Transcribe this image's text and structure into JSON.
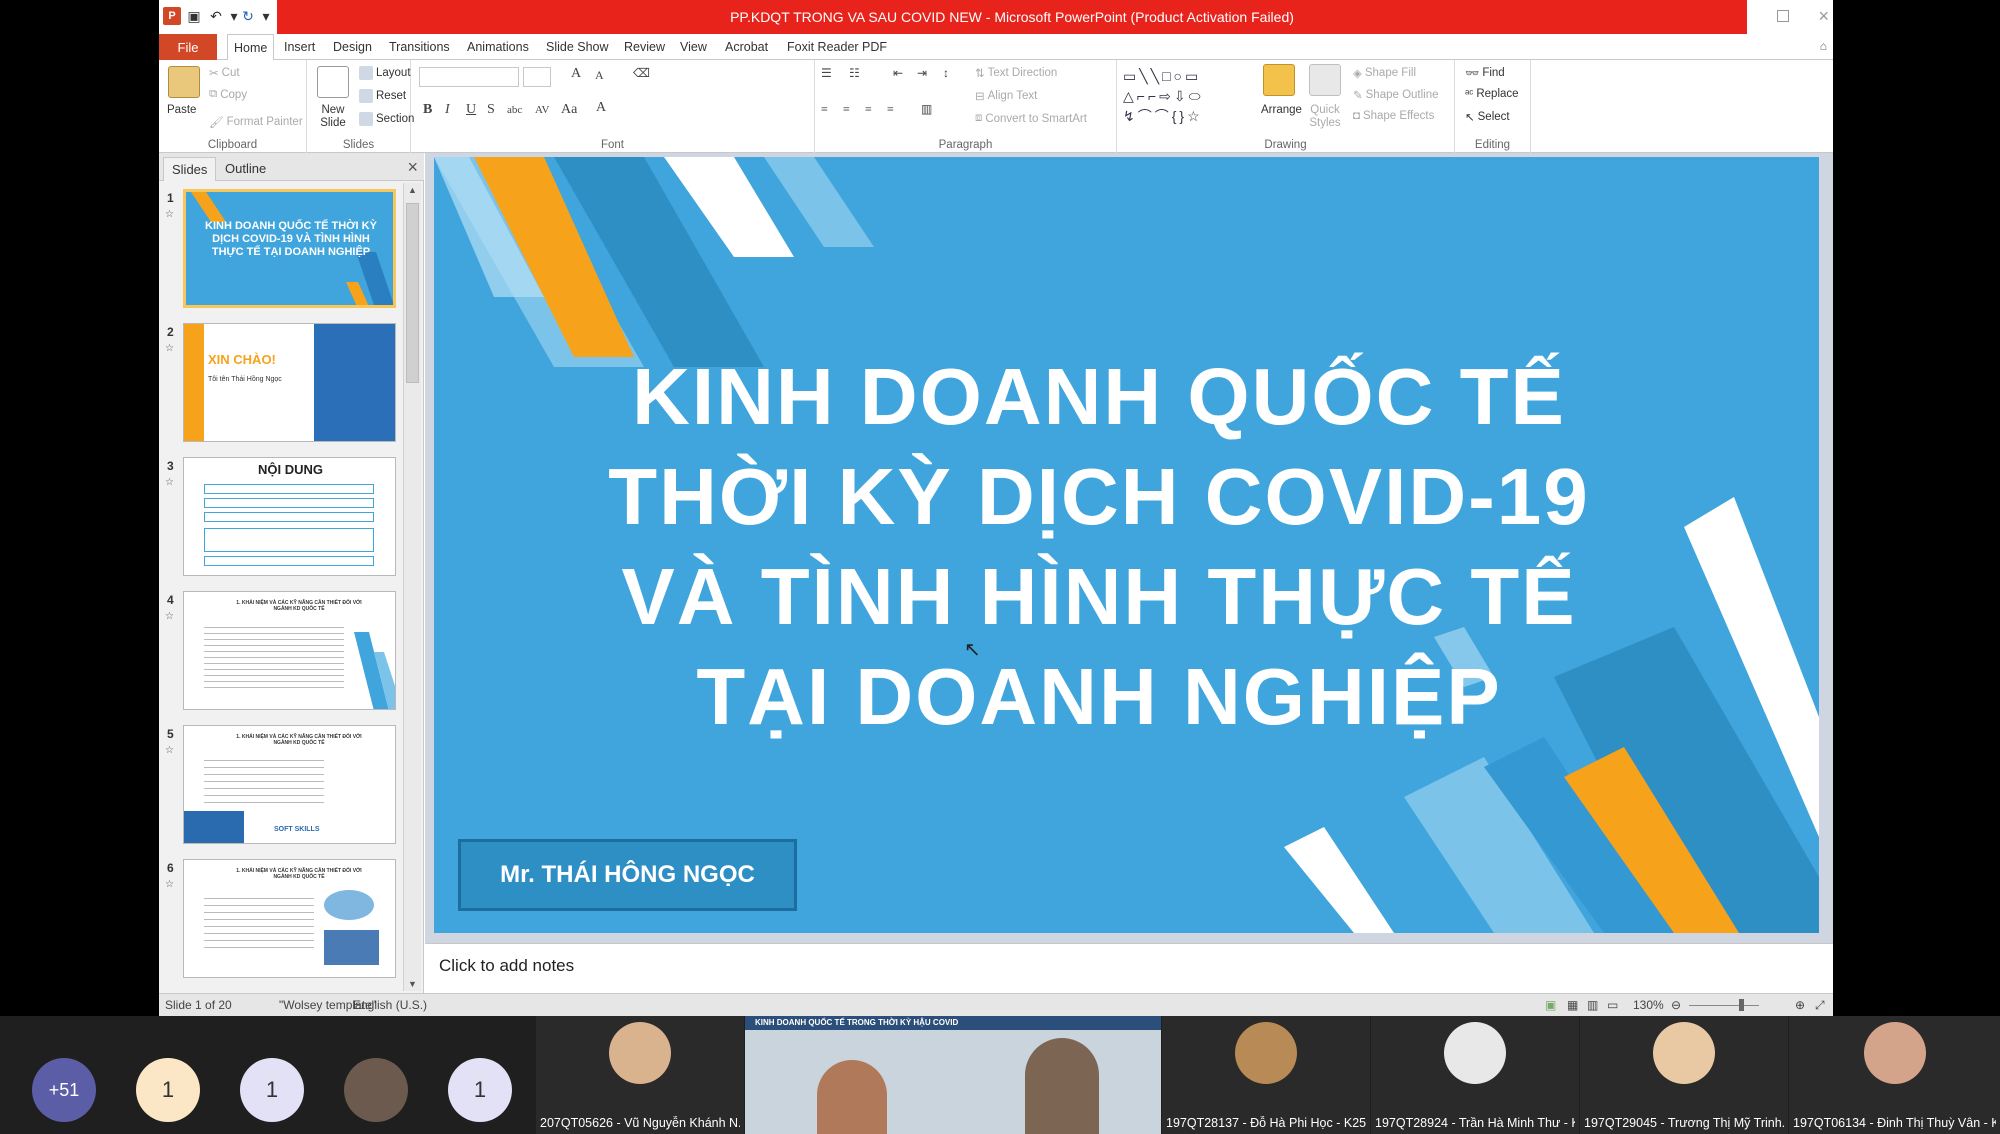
{
  "app": {
    "window_title": "PP.KDQT TRONG VA SAU COVID NEW - Microsoft PowerPoint (Product Activation Failed)"
  },
  "menu": {
    "file": "File",
    "tabs": [
      "Home",
      "Insert",
      "Design",
      "Transitions",
      "Animations",
      "Slide Show",
      "Review",
      "View",
      "Acrobat",
      "Foxit Reader PDF"
    ]
  },
  "ribbon": {
    "clipboard": {
      "label": "Clipboard",
      "paste": "Paste",
      "cut": "Cut",
      "copy": "Copy",
      "format_painter": "Format Painter"
    },
    "slides": {
      "label": "Slides",
      "new_slide": "New Slide",
      "layout": "Layout",
      "reset": "Reset",
      "section": "Section"
    },
    "font": {
      "label": "Font"
    },
    "paragraph": {
      "label": "Paragraph",
      "text_direction": "Text Direction",
      "align_text": "Align Text",
      "convert_smartart": "Convert to SmartArt"
    },
    "drawing": {
      "label": "Drawing",
      "arrange": "Arrange",
      "quick_styles": "Quick Styles",
      "shape_fill": "Shape Fill",
      "shape_outline": "Shape Outline",
      "shape_effects": "Shape Effects"
    },
    "editing": {
      "label": "Editing",
      "find": "Find",
      "replace": "Replace",
      "select": "Select"
    }
  },
  "slides_pane": {
    "tab_slides": "Slides",
    "tab_outline": "Outline",
    "thumbnails": [
      {
        "num": "1",
        "text": "KINH DOANH QUỐC TẾ THỜI KỲ DỊCH COVID-19 VÀ TÌNH HÌNH THỰC TẾ TẠI DOANH NGHIỆP"
      },
      {
        "num": "2",
        "text": "XIN CHÀO!"
      },
      {
        "num": "3",
        "text": "NỘI DUNG"
      },
      {
        "num": "4",
        "text": "1. KHÁI NIỆM VÀ CÁC KỸ NĂNG CẦN THIẾT ĐỐI VỚI NGÀNH KD QUỐC TẾ"
      },
      {
        "num": "5",
        "text": "1. KHÁI NIỆM VÀ CÁC KỸ NĂNG CẦN THIẾT ĐỐI VỚI NGÀNH KD QUỐC TẾ"
      },
      {
        "num": "6",
        "text": "1. KHÁI NIỆM VÀ CÁC KỸ NĂNG CẦN THIẾT ĐỐI VỚI NGÀNH KD QUỐC TẾ"
      }
    ],
    "thumb2_name": "Tôi tên Thái Hồng Ngọc",
    "thumb5_caption": "SOFT SKILLS"
  },
  "slide": {
    "title_lines": [
      "KINH DOANH QUỐC TẾ",
      "THỜI KỲ DỊCH COVID-19",
      "VÀ TÌNH HÌNH THỰC TẾ",
      "TẠI DOANH NGHIỆP"
    ],
    "presenter": "Mr. THÁI HÔNG NGỌC"
  },
  "notes": {
    "placeholder": "Click to add notes"
  },
  "status": {
    "slide_info": "Slide 1 of 20",
    "theme": "\"Wolsey template\"",
    "language": "English (U.S.)",
    "zoom": "130%"
  },
  "meeting": {
    "overflow_count": "+51",
    "badges": [
      "1",
      "1",
      "1"
    ],
    "video_banner": "KINH DOANH QUỐC TẾ TRONG THỜI KỲ HẬU COVID",
    "participants": [
      "207QT05626 - Vũ Nguyễn Khánh N...",
      "197QT28137 - Đỗ Hà Phi Học - K25...",
      "197QT28924 - Trần Hà Minh Thư - K...",
      "197QT29045 - Trương Thị Mỹ Trinh...",
      "197QT06134 - Đinh Thị Thuỳ Vân - K..."
    ]
  },
  "colors": {
    "slide_bg": "#3fa5dc",
    "title_bar_red": "#e8231c",
    "file_tab": "#d24726",
    "accent_orange": "#f7a21b"
  }
}
